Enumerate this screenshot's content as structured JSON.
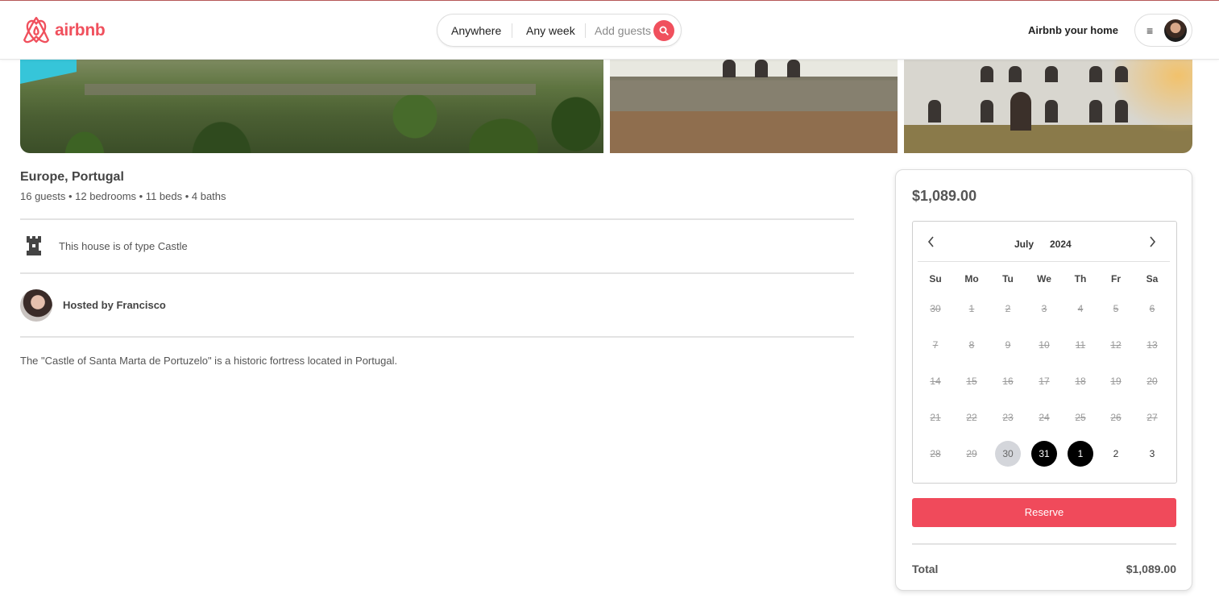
{
  "header": {
    "brand": "airbnb",
    "search": {
      "location": "Anywhere",
      "dates": "Any week",
      "guests_placeholder": "Add guests"
    },
    "host_link": "Airbnb your home",
    "menu_icon": "≡"
  },
  "listing": {
    "location": "Europe, Portugal",
    "details": "16 guests • 12 bedrooms • 11 beds • 4 baths",
    "type_text": "This house is of type Castle",
    "host_text": "Hosted by Francisco",
    "description": "The \"Castle of Santa Marta de Portuzelo\" is a historic fortress located in Portugal."
  },
  "booking": {
    "price": "$1,089.00",
    "calendar": {
      "month": "July",
      "year": "2024",
      "weekdays": [
        "Su",
        "Mo",
        "Tu",
        "We",
        "Th",
        "Fr",
        "Sa"
      ],
      "weeks": [
        [
          {
            "d": "30",
            "s": "dis"
          },
          {
            "d": "1",
            "s": "dis"
          },
          {
            "d": "2",
            "s": "dis"
          },
          {
            "d": "3",
            "s": "dis"
          },
          {
            "d": "4",
            "s": "dis"
          },
          {
            "d": "5",
            "s": "dis"
          },
          {
            "d": "6",
            "s": "dis"
          }
        ],
        [
          {
            "d": "7",
            "s": "dis"
          },
          {
            "d": "8",
            "s": "dis"
          },
          {
            "d": "9",
            "s": "dis"
          },
          {
            "d": "10",
            "s": "dis"
          },
          {
            "d": "11",
            "s": "dis"
          },
          {
            "d": "12",
            "s": "dis"
          },
          {
            "d": "13",
            "s": "dis"
          }
        ],
        [
          {
            "d": "14",
            "s": "dis"
          },
          {
            "d": "15",
            "s": "dis"
          },
          {
            "d": "16",
            "s": "dis"
          },
          {
            "d": "17",
            "s": "dis"
          },
          {
            "d": "18",
            "s": "dis"
          },
          {
            "d": "19",
            "s": "dis"
          },
          {
            "d": "20",
            "s": "dis"
          }
        ],
        [
          {
            "d": "21",
            "s": "dis"
          },
          {
            "d": "22",
            "s": "dis"
          },
          {
            "d": "23",
            "s": "dis"
          },
          {
            "d": "24",
            "s": "dis"
          },
          {
            "d": "25",
            "s": "dis"
          },
          {
            "d": "26",
            "s": "dis"
          },
          {
            "d": "27",
            "s": "dis"
          }
        ],
        [
          {
            "d": "28",
            "s": "dis"
          },
          {
            "d": "29",
            "s": "dis"
          },
          {
            "d": "30",
            "s": "pending"
          },
          {
            "d": "31",
            "s": "sel"
          },
          {
            "d": "1",
            "s": "sel"
          },
          {
            "d": "2",
            "s": "en"
          },
          {
            "d": "3",
            "s": "en"
          }
        ]
      ]
    },
    "reserve_label": "Reserve",
    "total_label": "Total",
    "total_value": "$1,089.00"
  },
  "colors": {
    "brand": "#f0505d",
    "reserve": "#f04a5b",
    "selected_day": "#000000",
    "pending_day": "#d4d6db"
  },
  "icons": [
    "airbnb-logo-icon",
    "search-icon",
    "menu-icon",
    "castle-icon",
    "chevron-left-icon",
    "chevron-right-icon"
  ]
}
